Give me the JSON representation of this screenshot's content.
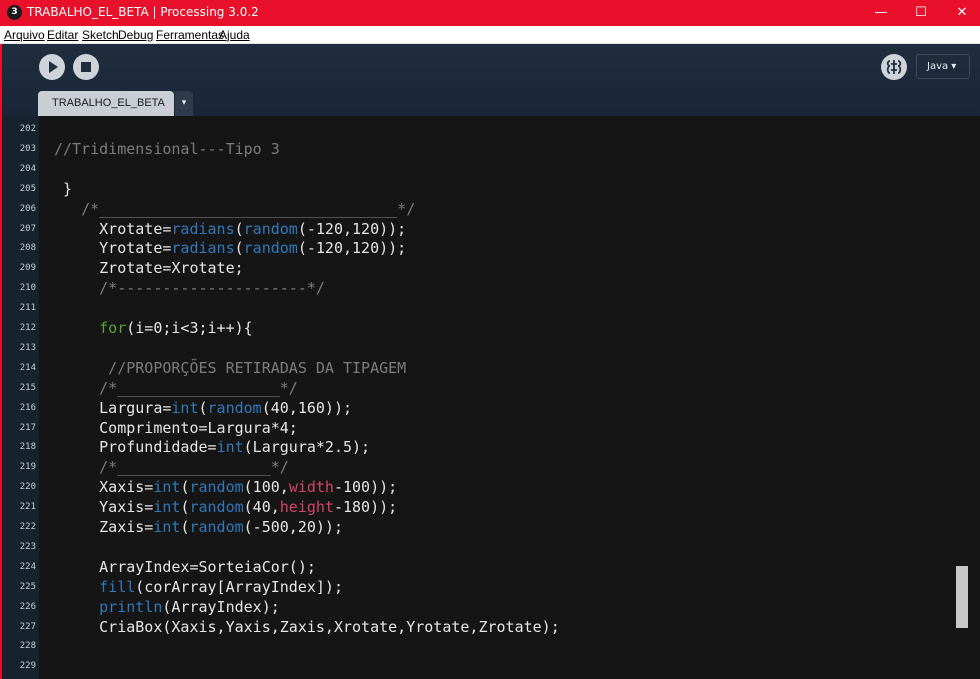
{
  "window": {
    "title": "TRABALHO_EL_BETA | Processing 3.0.2",
    "app_icon": "3",
    "controls": {
      "minimize": "—",
      "maximize": "☐",
      "close": "✕"
    },
    "accent_color": "#e8102a"
  },
  "menu": {
    "items": [
      "Arquivo",
      "Editar",
      "Sketch",
      "Debug",
      "Ferramentas",
      "Ajuda"
    ]
  },
  "toolbar": {
    "run_icon": "play-icon",
    "stop_icon": "stop-icon",
    "debug_icon": "debugger-icon",
    "mode_label": "Java ▾"
  },
  "tabs": {
    "active_label": "TRABALHO_EL_BETA",
    "menu_arrow": "▾"
  },
  "editor": {
    "lines": [
      {
        "n": "202",
        "t": ""
      },
      {
        "n": "203",
        "t": "//Tridimensional---Tipo 3"
      },
      {
        "n": "204",
        "t": ""
      },
      {
        "n": "205",
        "t": " }"
      },
      {
        "n": "206",
        "t": "   /*_________________________________*/"
      },
      {
        "n": "207",
        "t": "     Xrotate=radians(random(-120,120));"
      },
      {
        "n": "208",
        "t": "     Yrotate=radians(random(-120,120));"
      },
      {
        "n": "209",
        "t": "     Zrotate=Xrotate;"
      },
      {
        "n": "210",
        "t": "     /*---------------------*/"
      },
      {
        "n": "211",
        "t": ""
      },
      {
        "n": "212",
        "t": "     for(i=0;i<3;i++){"
      },
      {
        "n": "213",
        "t": ""
      },
      {
        "n": "214",
        "t": "      //PROPORÇÕES RETIRADAS DA TIPAGEM"
      },
      {
        "n": "215",
        "t": "     /*__________________*/"
      },
      {
        "n": "216",
        "t": "     Largura=int(random(40,160));"
      },
      {
        "n": "217",
        "t": "     Comprimento=Largura*4;"
      },
      {
        "n": "218",
        "t": "     Profundidade=int(Largura*2.5);"
      },
      {
        "n": "219",
        "t": "     /*_________________*/"
      },
      {
        "n": "220",
        "t": "     Xaxis=int(random(100,width-100));"
      },
      {
        "n": "221",
        "t": "     Yaxis=int(random(40,height-180));"
      },
      {
        "n": "222",
        "t": "     Zaxis=int(random(-500,20));"
      },
      {
        "n": "223",
        "t": ""
      },
      {
        "n": "224",
        "t": "     ArrayIndex=SorteiaCor();"
      },
      {
        "n": "225",
        "t": "     fill(corArray[ArrayIndex]);"
      },
      {
        "n": "226",
        "t": "     println(ArrayIndex);"
      },
      {
        "n": "227",
        "t": "     CriaBox(Xaxis,Yaxis,Zaxis,Xrotate,Yrotate,Zrotate);"
      },
      {
        "n": "228",
        "t": ""
      },
      {
        "n": "229",
        "t": ""
      }
    ],
    "colors": {
      "comment": "#7c7c7c",
      "function": "#2f79bb",
      "keyword": "#55a330",
      "builtin_var": "#d6426b",
      "text": "#e6e6e6",
      "background": "#151515"
    }
  }
}
